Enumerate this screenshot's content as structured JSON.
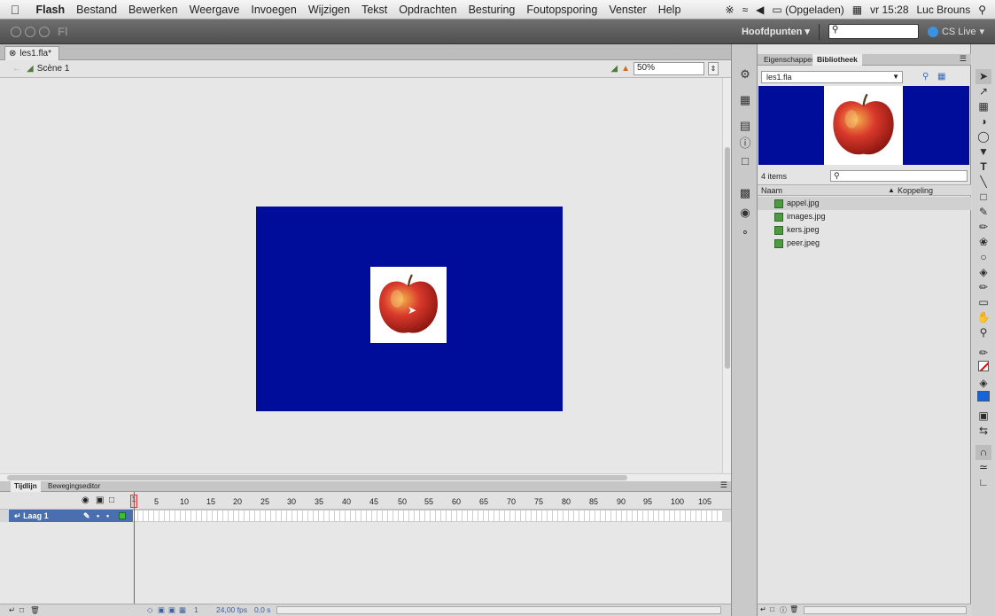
{
  "menubar": {
    "app": "Flash",
    "items": [
      "Bestand",
      "Bewerken",
      "Weergave",
      "Invoegen",
      "Wijzigen",
      "Tekst",
      "Opdrachten",
      "Besturing",
      "Foutopsporing",
      "Venster",
      "Help"
    ],
    "battery": "(Opgeladen)",
    "clock": "vr 15:28",
    "user": "Luc Brouns"
  },
  "appbar": {
    "logo": "Fl",
    "workspace": "Hoofdpunten ▾",
    "search_icon": "search-icon",
    "cs_live": "CS Live"
  },
  "document": {
    "tab": "les1.fla*",
    "scene": "Scène 1",
    "zoom": "50%"
  },
  "stage": {
    "background": "#000C9A"
  },
  "timeline": {
    "tab_timeline": "Tijdlijn",
    "tab_motion": "Bewegingseditor",
    "frame_numbers": [
      "1",
      "5",
      "10",
      "15",
      "20",
      "25",
      "30",
      "35",
      "40",
      "45",
      "50",
      "55",
      "60",
      "65",
      "70",
      "75",
      "80",
      "85",
      "90",
      "95",
      "100",
      "105"
    ],
    "layer": "Laag 1",
    "current_frame": "1",
    "fps": "24,00 fps",
    "time": "0,0 s"
  },
  "library": {
    "tab_properties": "Eigenschappen",
    "tab_library": "Bibliotheek",
    "document": "les1.fla",
    "count": "4 items",
    "col_name": "Naam",
    "col_link": "Koppeling",
    "items": [
      "appel.jpg",
      "images.jpg",
      "kers.jpeg",
      "peer.jpeg"
    ]
  }
}
